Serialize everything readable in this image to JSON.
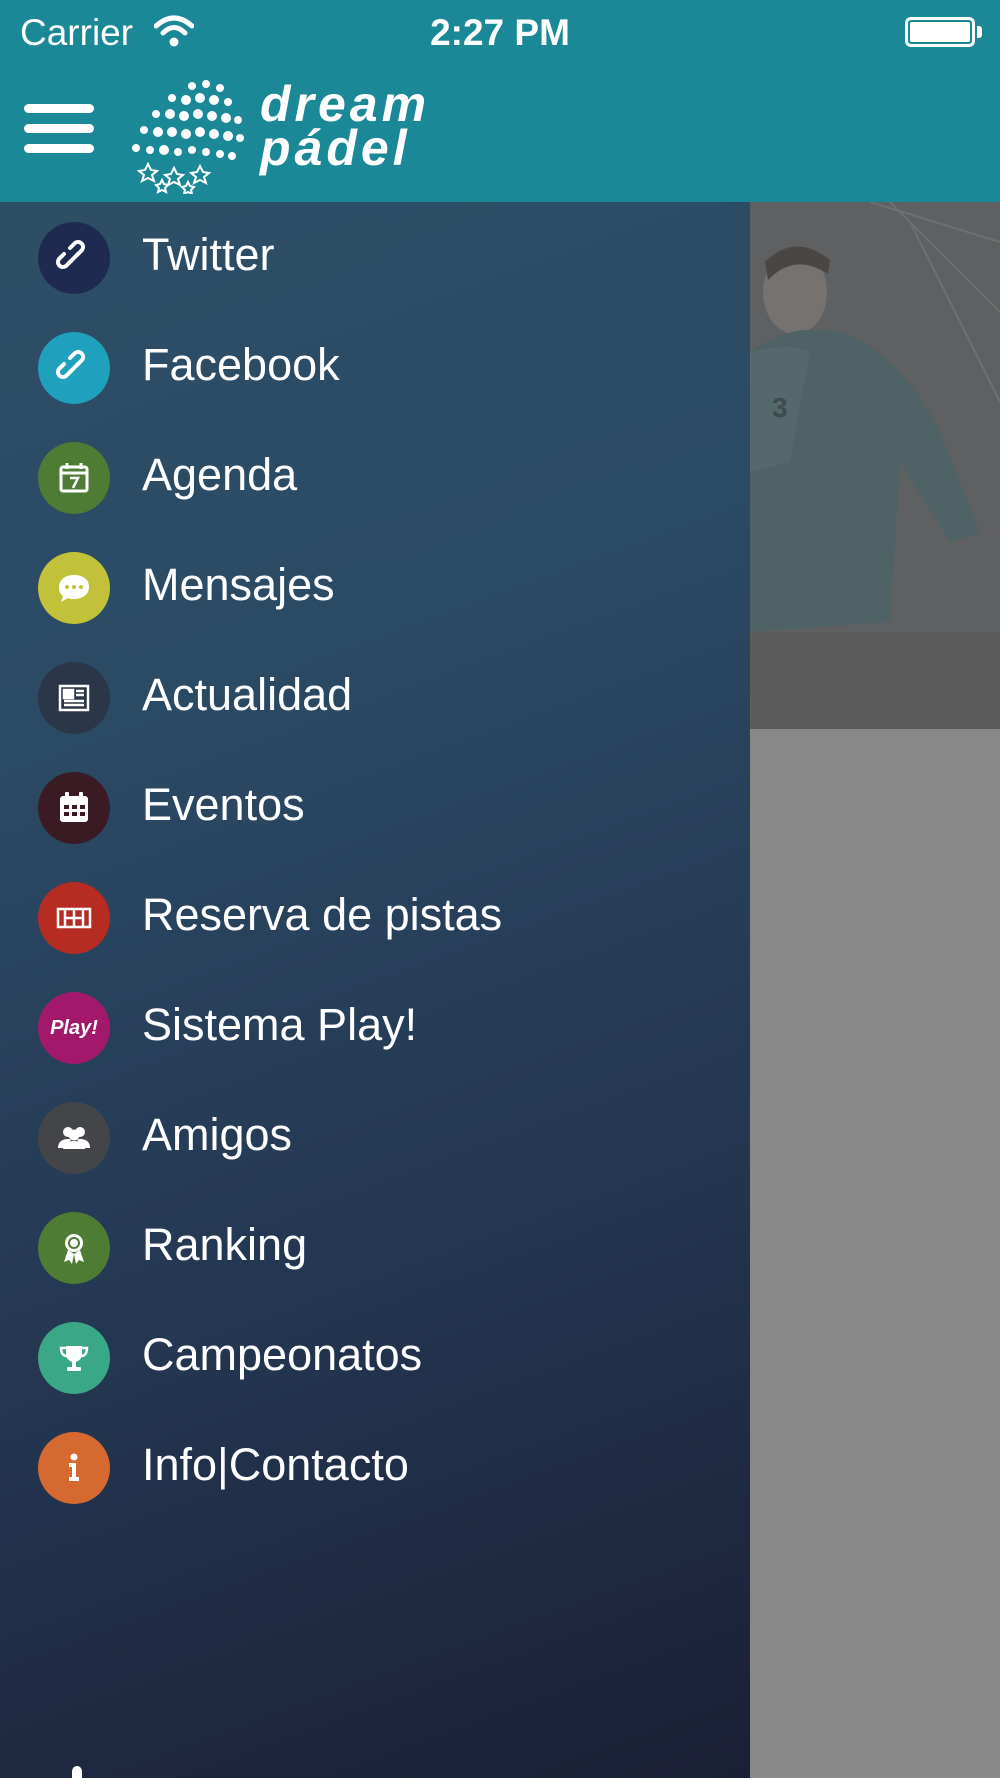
{
  "status_bar": {
    "carrier": "Carrier",
    "time": "2:27 PM",
    "wifi_icon": "wifi-icon",
    "battery_icon": "battery-icon"
  },
  "header": {
    "menu_icon": "hamburger-icon",
    "logo_line1": "dream",
    "logo_line2": "pádel",
    "background_color": "#1a8896"
  },
  "drawer": {
    "items": [
      {
        "label": "Twitter",
        "icon": "link-icon",
        "color": "#1e2a4f"
      },
      {
        "label": "Facebook",
        "icon": "link-icon",
        "color": "#1fa0bd"
      },
      {
        "label": "Agenda",
        "icon": "calendar-7-icon",
        "color": "#4e7c34"
      },
      {
        "label": "Mensajes",
        "icon": "chat-bubble-icon",
        "color": "#c2c23a"
      },
      {
        "label": "Actualidad",
        "icon": "newspaper-icon",
        "color": "#2b3648"
      },
      {
        "label": "Eventos",
        "icon": "calendar-grid-icon",
        "color": "#3a1b24"
      },
      {
        "label": "Reserva de pistas",
        "icon": "court-icon",
        "color": "#b62c23"
      },
      {
        "label": "Sistema Play!",
        "icon": "play-badge-icon",
        "color": "#a2196c",
        "badge_text": "Play!"
      },
      {
        "label": "Amigos",
        "icon": "friends-icon",
        "color": "#434549"
      },
      {
        "label": "Ranking",
        "icon": "award-ribbon-icon",
        "color": "#4e7c34"
      },
      {
        "label": "Campeonatos",
        "icon": "trophy-icon",
        "color": "#3aa786"
      },
      {
        "label": "Info|Contacto",
        "icon": "info-icon",
        "color": "#d6692f"
      }
    ]
  }
}
